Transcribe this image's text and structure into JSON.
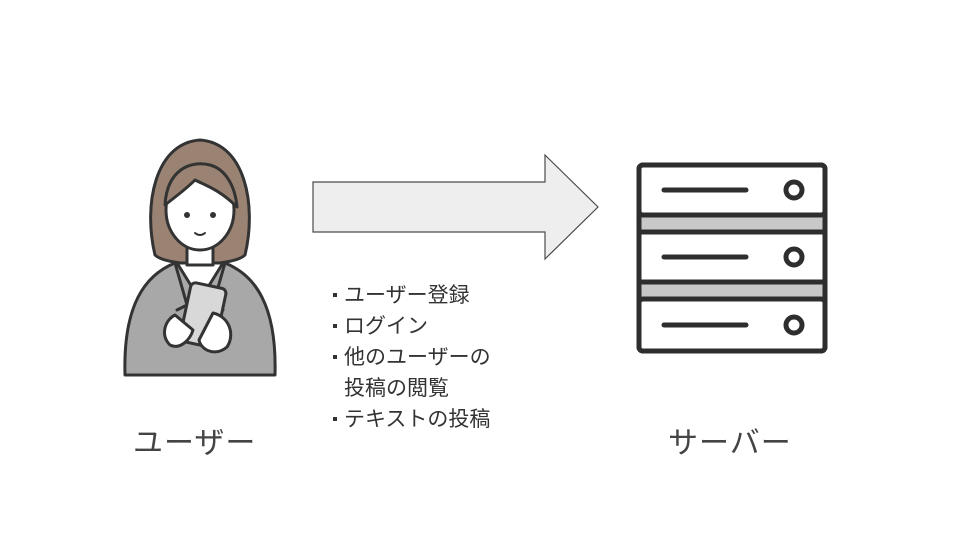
{
  "user": {
    "icon": "woman-with-smartphone-icon",
    "label": "ユーザー"
  },
  "arrow": {
    "icon": "right-arrow-icon"
  },
  "actions": [
    "ユーザー登録",
    "ログイン",
    "他のユーザーの\n投稿の閲覧",
    "テキストの投稿"
  ],
  "server": {
    "icon": "server-rack-icon",
    "label": "サーバー"
  },
  "colors": {
    "hair": "#9a8372",
    "jacket": "#a8a8a8",
    "arrow_fill": "#eeeeee",
    "outline": "#333333"
  }
}
